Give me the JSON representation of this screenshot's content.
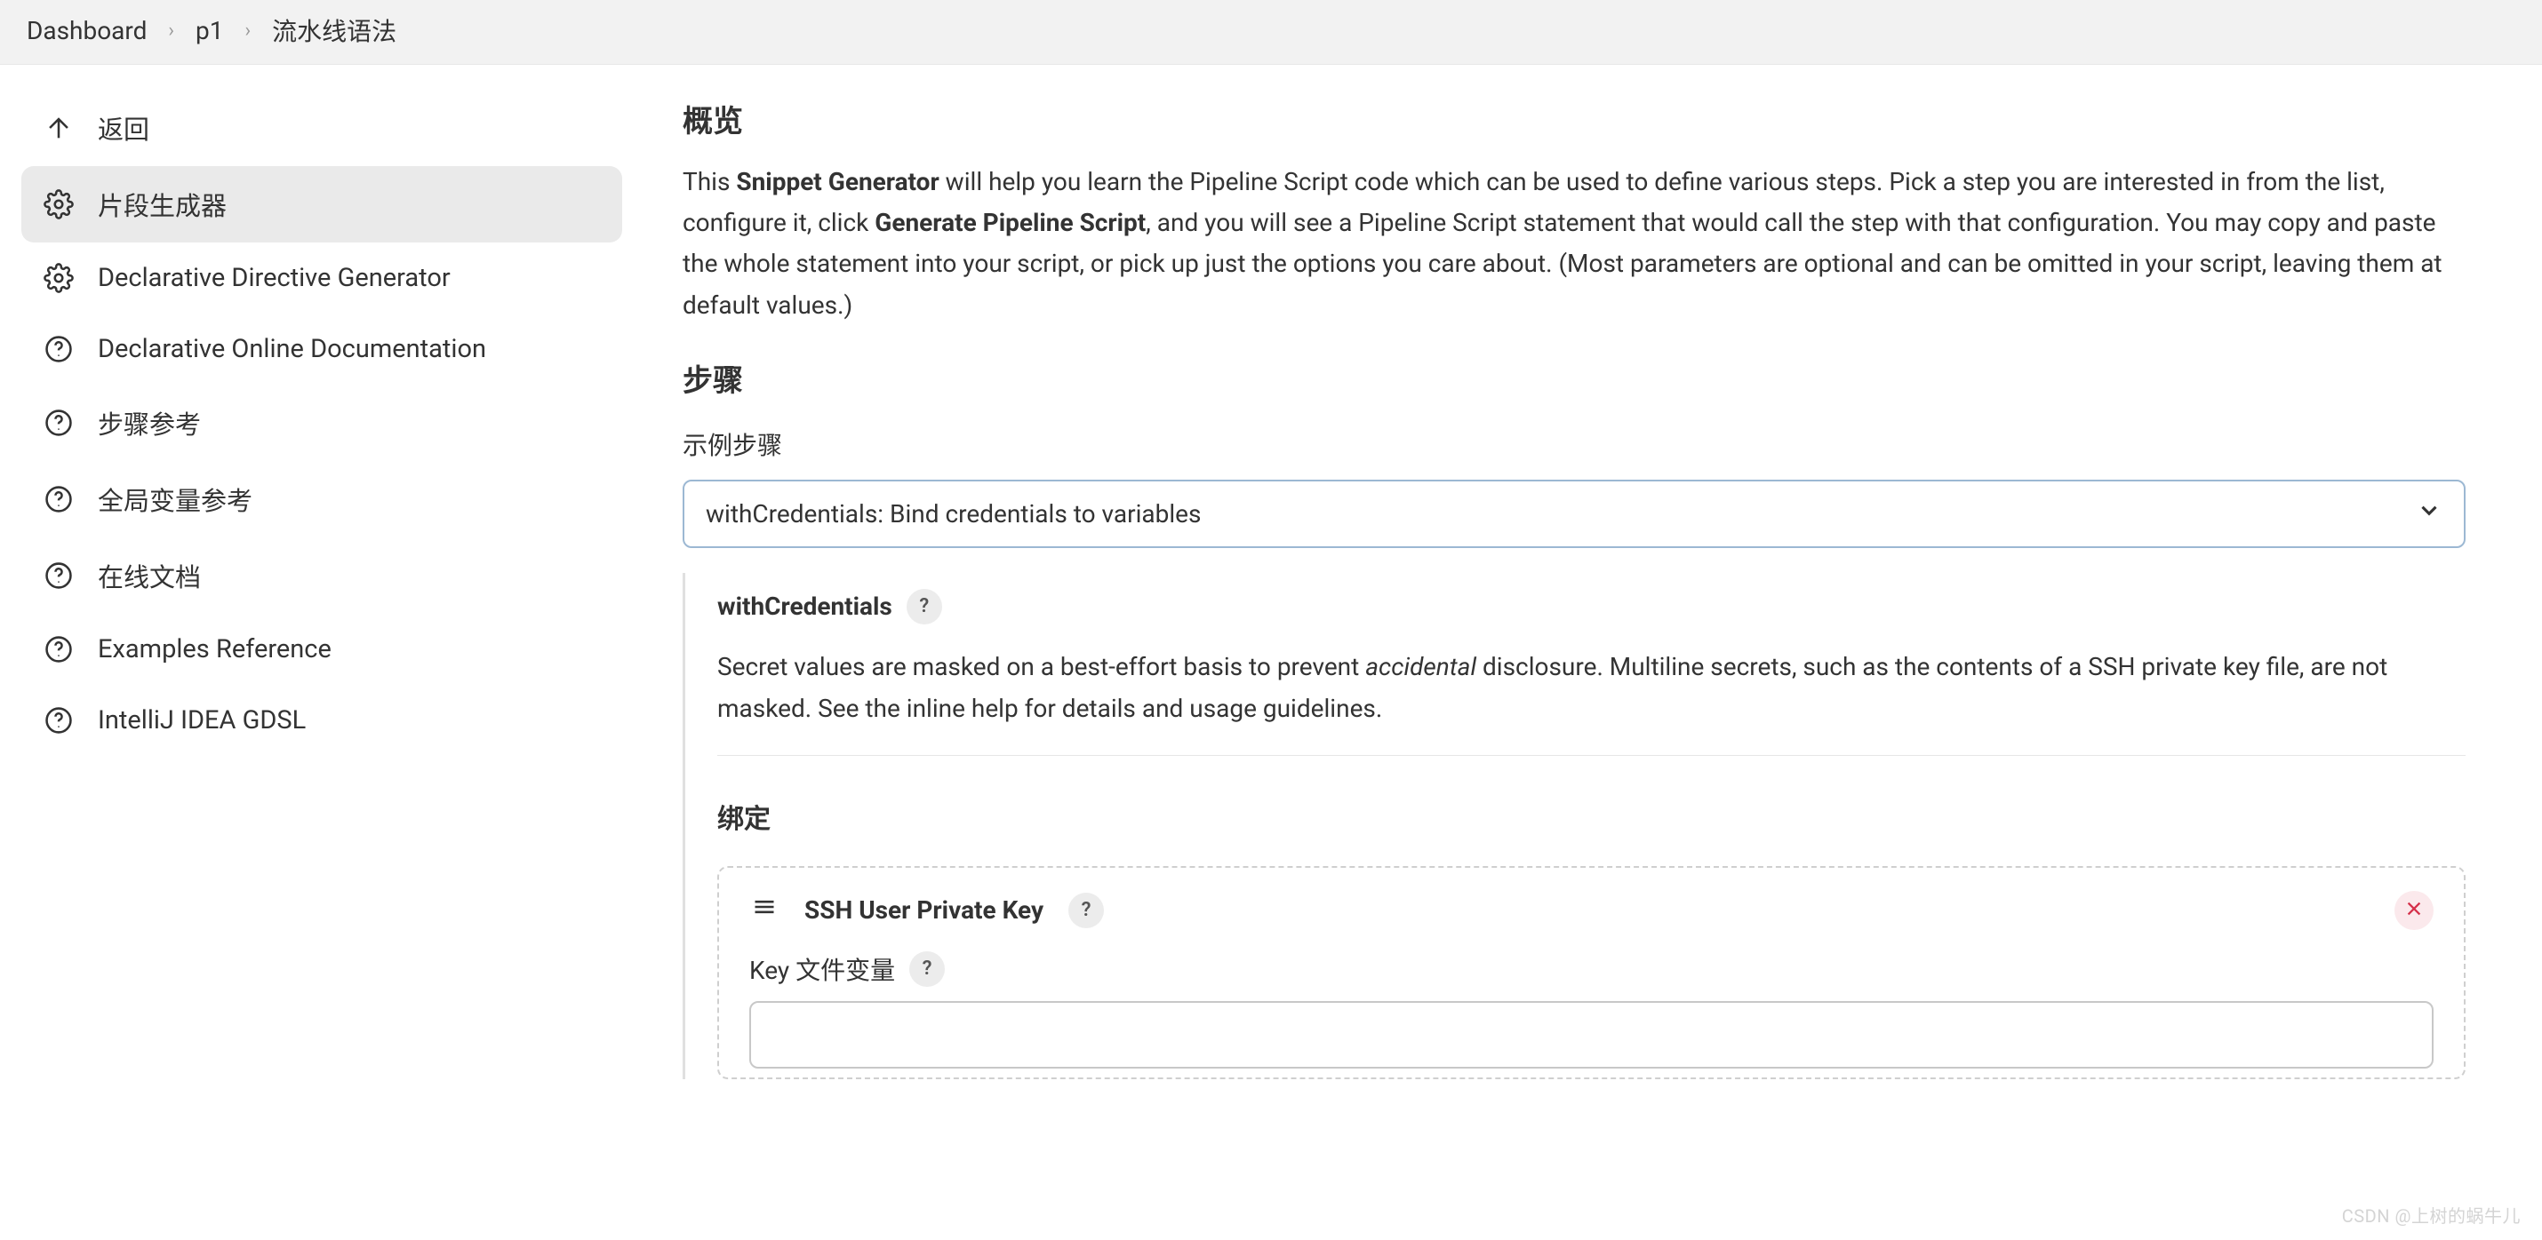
{
  "breadcrumb": {
    "items": [
      "Dashboard",
      "p1",
      "流水线语法"
    ]
  },
  "sidebar": {
    "items": [
      {
        "label": "返回",
        "icon": "arrow-up"
      },
      {
        "label": "片段生成器",
        "icon": "gear",
        "active": true
      },
      {
        "label": "Declarative Directive Generator",
        "icon": "gear"
      },
      {
        "label": "Declarative Online Documentation",
        "icon": "help"
      },
      {
        "label": "步骤参考",
        "icon": "help"
      },
      {
        "label": "全局变量参考",
        "icon": "help"
      },
      {
        "label": "在线文档",
        "icon": "help"
      },
      {
        "label": "Examples Reference",
        "icon": "help"
      },
      {
        "label": "IntelliJ IDEA GDSL",
        "icon": "help"
      }
    ]
  },
  "main": {
    "overview_title": "概览",
    "overview_text_pre": "This ",
    "overview_bold1": "Snippet Generator",
    "overview_text_mid": " will help you learn the Pipeline Script code which can be used to define various steps. Pick a step you are interested in from the list, configure it, click ",
    "overview_bold2": "Generate Pipeline Script",
    "overview_text_post": ", and you will see a Pipeline Script statement that would call the step with that configuration. You may copy and paste the whole statement into your script, or pick up just the options you care about. (Most parameters are optional and can be omitted in your script, leaving them at default values.)",
    "steps_title": "步骤",
    "example_step_label": "示例步骤",
    "step_select_value": "withCredentials: Bind credentials to variables",
    "detail": {
      "title": "withCredentials",
      "desc_pre": "Secret values are masked on a best-effort basis to prevent ",
      "desc_em": "accidental",
      "desc_post": " disclosure. Multiline secrets, such as the contents of a SSH private key file, are not masked. See the inline help for details and usage guidelines.",
      "bind_title": "绑定",
      "binding_type": "SSH User Private Key",
      "key_var_label": "Key 文件变量",
      "key_var_value": ""
    },
    "help_glyph": "?"
  },
  "watermark": "CSDN @上树的蜗牛儿"
}
